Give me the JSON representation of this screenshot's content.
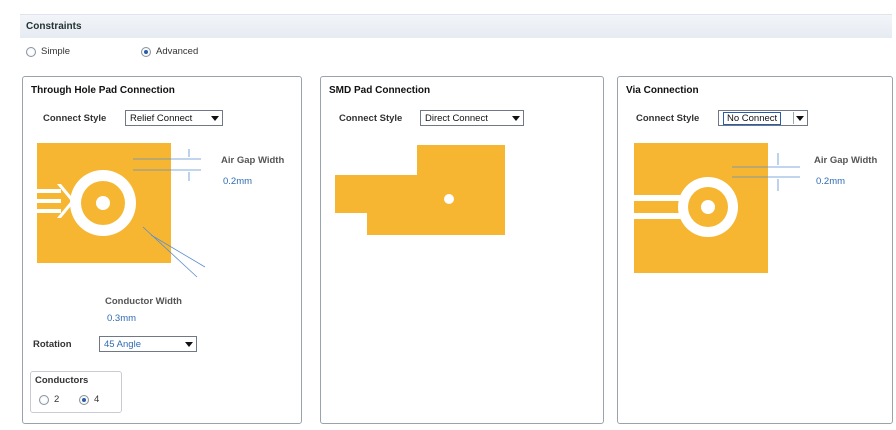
{
  "header": {
    "title": "Constraints"
  },
  "mode": {
    "options": [
      {
        "label": "Simple",
        "selected": false
      },
      {
        "label": "Advanced",
        "selected": true
      }
    ]
  },
  "colors": {
    "copper": "#f6b631",
    "dimension": "#5a8fd0",
    "value_text": "#2f6db3"
  },
  "through_hole": {
    "title": "Through Hole Pad Connection",
    "connect_style_label": "Connect Style",
    "connect_style_value": "Relief Connect",
    "air_gap_label": "Air Gap Width",
    "air_gap_value": "0.2mm",
    "conductor_width_label": "Conductor Width",
    "conductor_width_value": "0.3mm",
    "rotation_label": "Rotation",
    "rotation_value": "45 Angle",
    "conductors_label": "Conductors",
    "conductors_options": [
      {
        "label": "2",
        "selected": false
      },
      {
        "label": "4",
        "selected": true
      }
    ]
  },
  "smd": {
    "title": "SMD Pad Connection",
    "connect_style_label": "Connect Style",
    "connect_style_value": "Direct Connect"
  },
  "via": {
    "title": "Via Connection",
    "connect_style_label": "Connect Style",
    "connect_style_value": "No Connect",
    "air_gap_label": "Air Gap Width",
    "air_gap_value": "0.2mm"
  }
}
